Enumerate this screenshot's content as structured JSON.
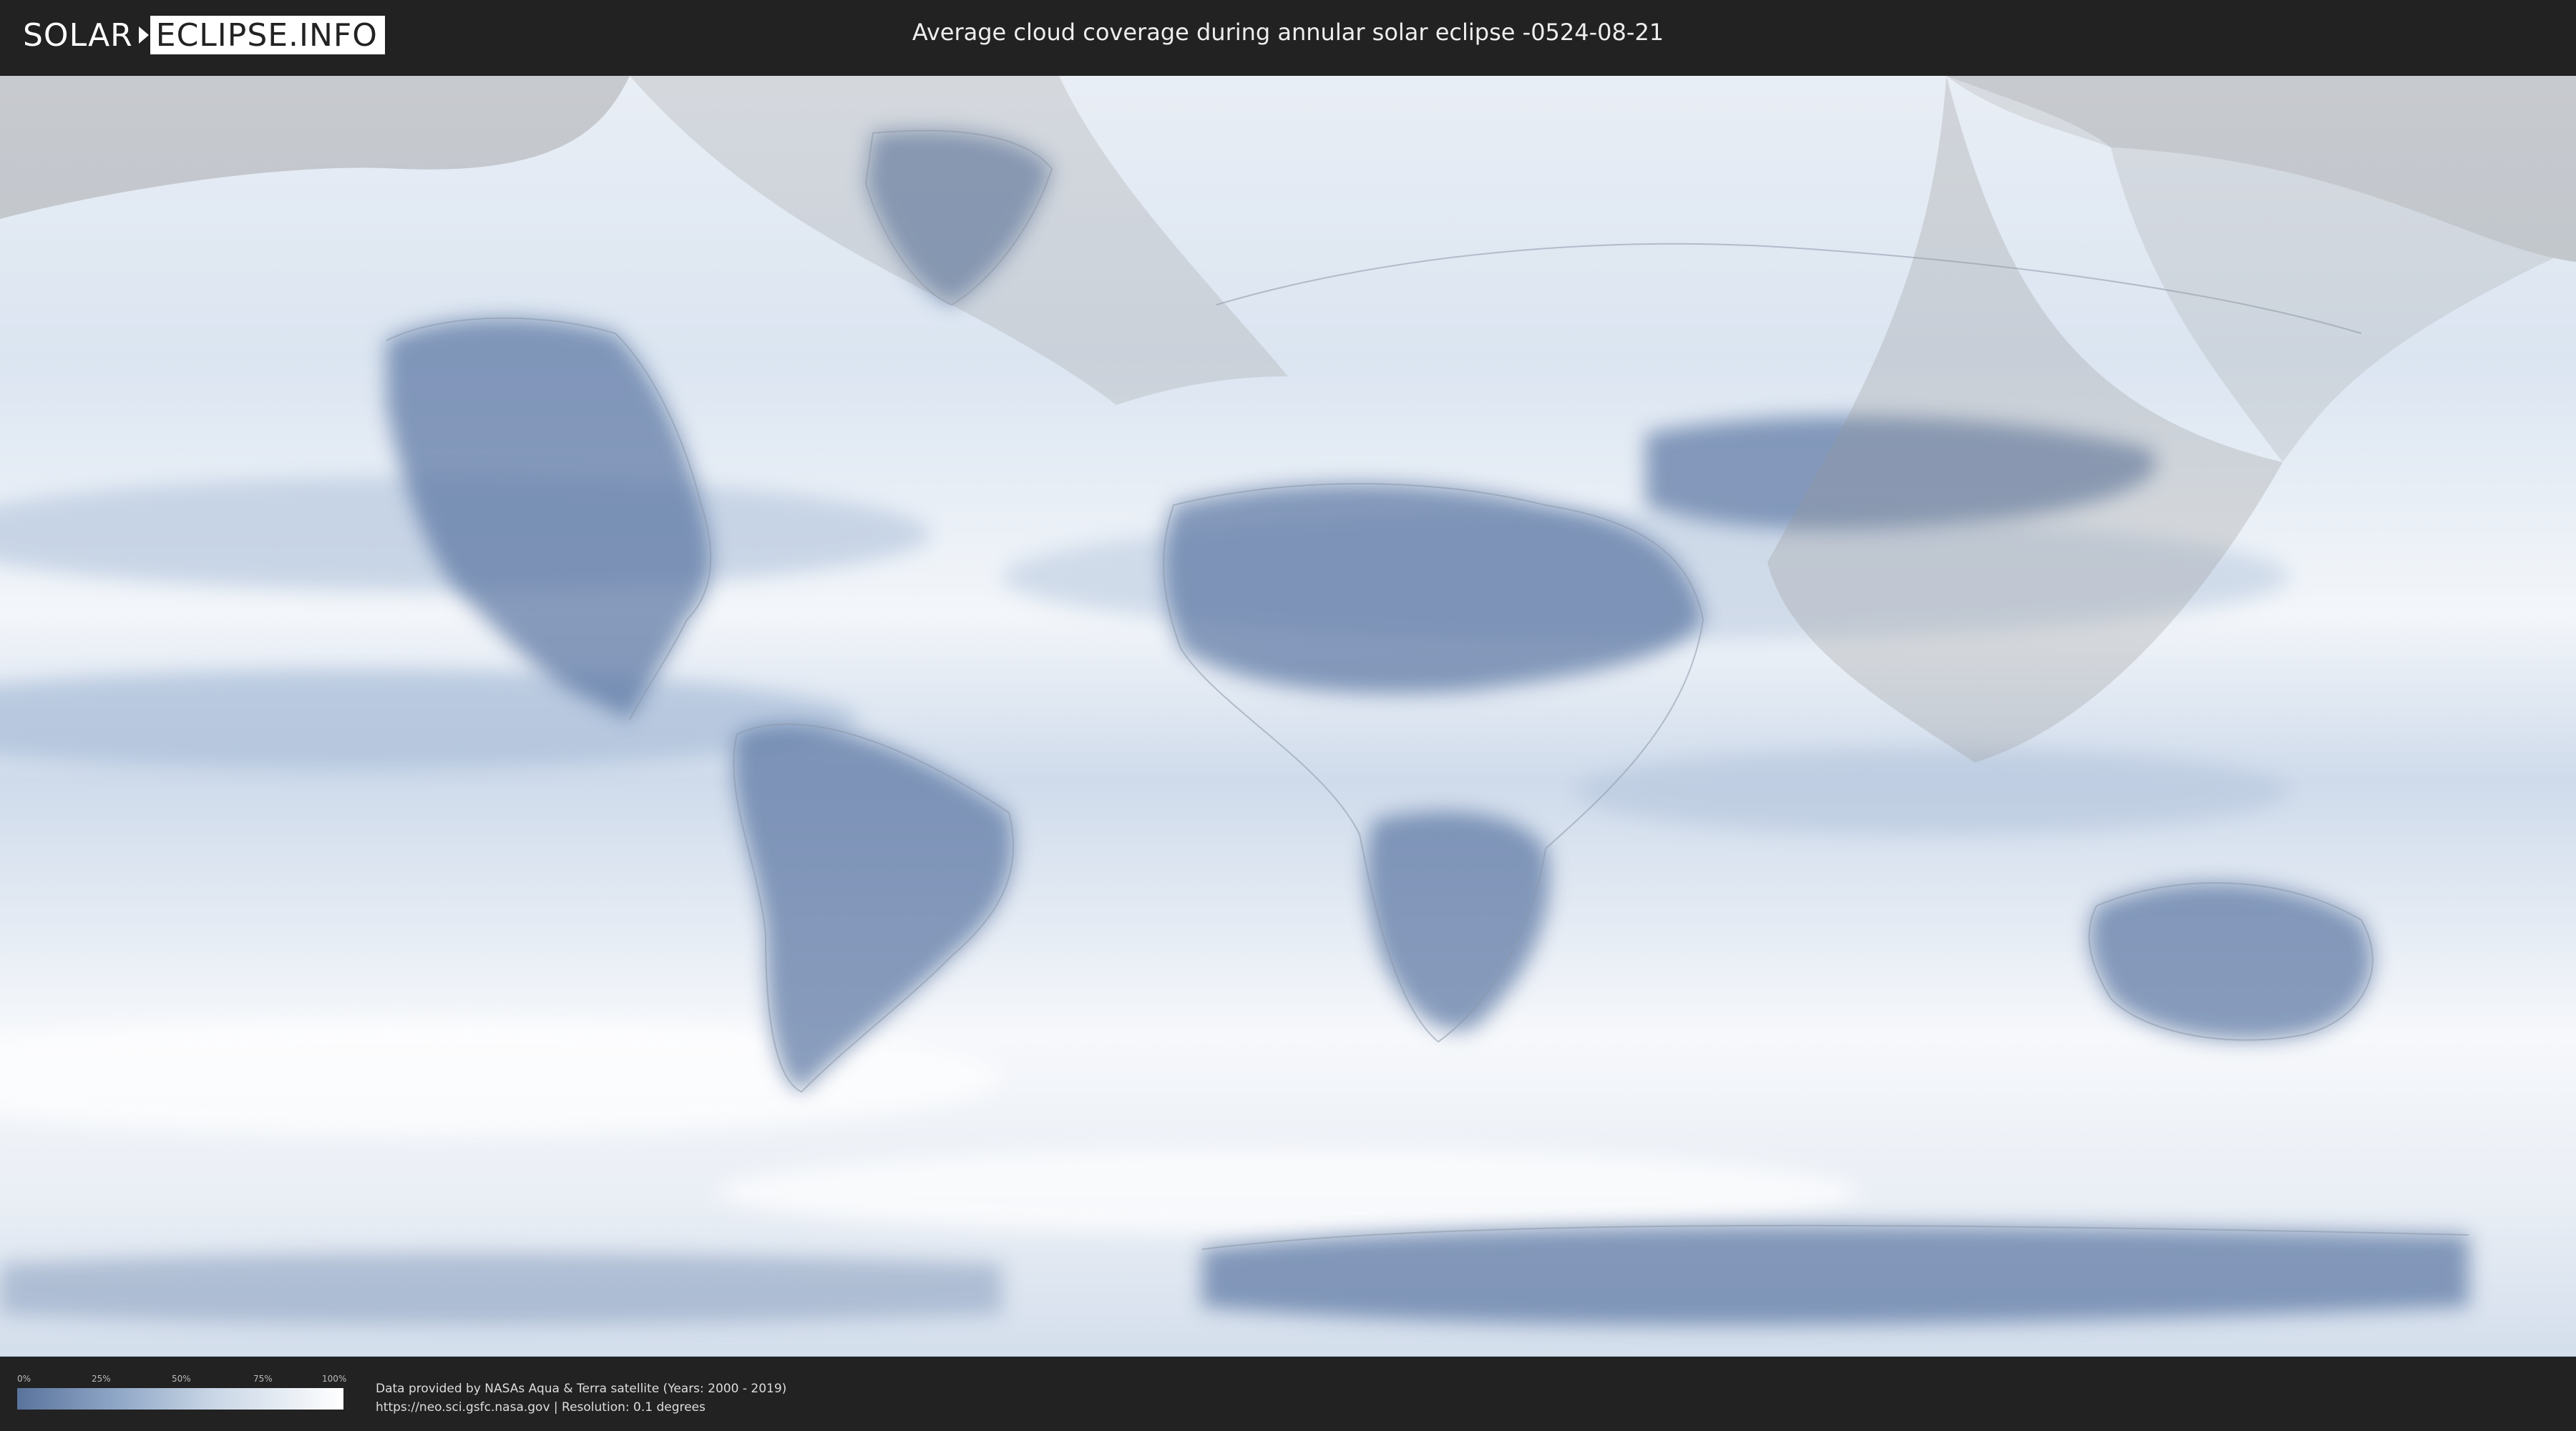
{
  "header": {
    "logo_left": "SOLAR",
    "logo_right": "ECLIPSE.INFO",
    "title": "Average cloud coverage during annular solar eclipse -0524-08-21"
  },
  "legend": {
    "ticks": [
      "0%",
      "25%",
      "50%",
      "75%",
      "100%"
    ],
    "colors": {
      "low": "#5a739c",
      "mid": "#c9d6e6",
      "high": "#ffffff"
    }
  },
  "footer": {
    "line1": "Data provided by NASAs Aqua & Terra satellite (Years: 2000 - 2019)",
    "line2": "https://neo.sci.gsfc.nasa.gov | Resolution: 0.1 degrees"
  },
  "map": {
    "overlay_color": "#9a9a9a",
    "land_color": "#5c77a3",
    "ocean_cloud_color": "#eef3f9"
  }
}
